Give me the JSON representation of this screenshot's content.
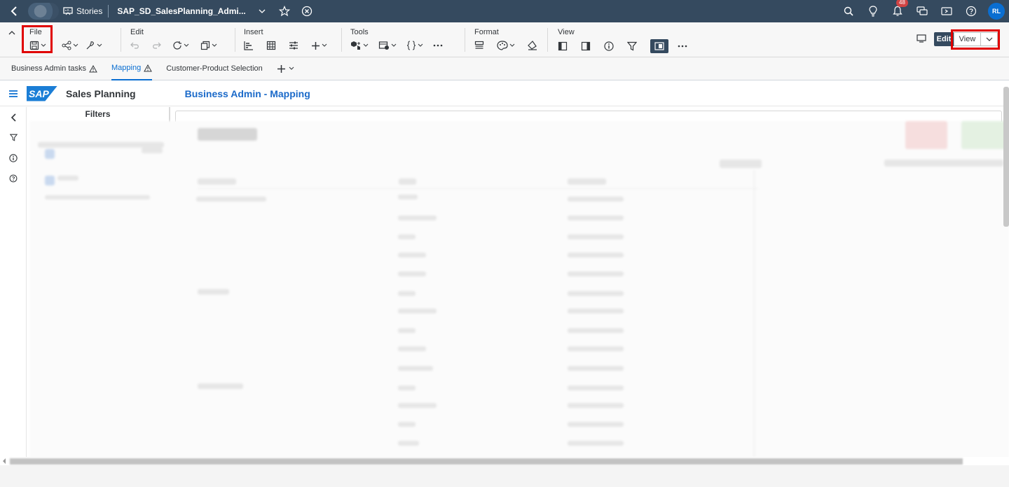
{
  "shell": {
    "stories_label": "Stories",
    "story_title": "SAP_SD_SalesPlanning_Admi...",
    "notification_count": "48",
    "avatar_initials": "RL"
  },
  "toolbar": {
    "groups": {
      "file": "File",
      "edit": "Edit",
      "insert": "Insert",
      "tools": "Tools",
      "format": "Format",
      "view": "View"
    },
    "edit_button": "Edit",
    "view_button": "View"
  },
  "tabs": [
    {
      "label": "Business Admin tasks",
      "warning": true
    },
    {
      "label": "Mapping",
      "warning": true,
      "active": true
    },
    {
      "label": "Customer-Product Selection",
      "warning": false
    }
  ],
  "app": {
    "name": "Sales Planning",
    "page_title": "Business Admin - Mapping",
    "logo_text": "SAP"
  },
  "filters": {
    "title": "Filters"
  },
  "colors": {
    "shell_bar": "#354a5f",
    "accent": "#0a6ed1",
    "highlight_box": "#e00000"
  }
}
